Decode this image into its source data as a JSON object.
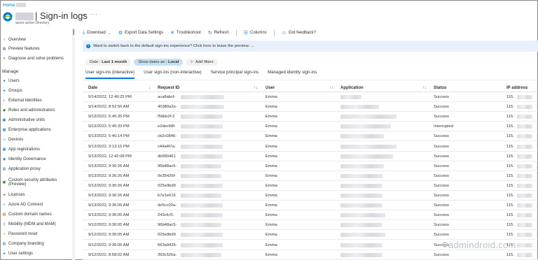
{
  "breadcrumb": {
    "home": "Home"
  },
  "header": {
    "title": "| Sign-in logs",
    "subtitle": "azure active Directory",
    "pin_icon": "pin-icon",
    "more_label": "···"
  },
  "sidebar": {
    "section_manage": "Manage",
    "items": [
      {
        "label": "Overview",
        "icon": "info-icon",
        "color": "#0078d4"
      },
      {
        "label": "Preview features",
        "icon": "preview-icon",
        "color": "#8764b8"
      },
      {
        "label": "Diagnose and solve problems",
        "icon": "wrench-icon",
        "color": "#605e5c"
      },
      {
        "label": "Users",
        "icon": "user-icon",
        "color": "#0078d4"
      },
      {
        "label": "Groups",
        "icon": "groups-icon",
        "color": "#0078d4"
      },
      {
        "label": "External Identities",
        "icon": "external-icon",
        "color": "#0078d4"
      },
      {
        "label": "Roles and administrators",
        "icon": "roles-icon",
        "color": "#107c10"
      },
      {
        "label": "Administrative units",
        "icon": "admin-units-icon",
        "color": "#0078d4"
      },
      {
        "label": "Enterprise applications",
        "icon": "apps-icon",
        "color": "#0078d4"
      },
      {
        "label": "Devices",
        "icon": "device-icon",
        "color": "#0078d4"
      },
      {
        "label": "App registrations",
        "icon": "app-reg-icon",
        "color": "#0078d4"
      },
      {
        "label": "Identity Governance",
        "icon": "governance-icon",
        "color": "#0078d4"
      },
      {
        "label": "Application proxy",
        "icon": "proxy-icon",
        "color": "#0078d4"
      },
      {
        "label": "Custom security attributes (Preview)",
        "icon": "attributes-icon",
        "color": "#107c10"
      },
      {
        "label": "Licenses",
        "icon": "license-icon",
        "color": "#d83b01"
      },
      {
        "label": "Azure AD Connect",
        "icon": "connect-icon",
        "color": "#0078d4"
      },
      {
        "label": "Custom domain names",
        "icon": "domain-icon",
        "color": "#d83b01"
      },
      {
        "label": "Mobility (MDM and MAM)",
        "icon": "mobility-icon",
        "color": "#0078d4"
      },
      {
        "label": "Password reset",
        "icon": "key-icon",
        "color": "#ffb900"
      },
      {
        "label": "Company branding",
        "icon": "branding-icon",
        "color": "#0078d4"
      },
      {
        "label": "User settings",
        "icon": "user-settings-icon",
        "color": "#0078d4"
      }
    ]
  },
  "toolbar": {
    "download": "Download",
    "export": "Export Data Settings",
    "troubleshoot": "Troubleshoot",
    "refresh": "Refresh",
    "columns": "Columns",
    "feedback": "Got feedback?"
  },
  "banner": {
    "text": "Want to switch back to the default sign-ins experience? Click here to leave the preview. →"
  },
  "filters": {
    "date_prefix": "Date : ",
    "date_value": "Last 1 month",
    "show_prefix": "Show dates as : ",
    "show_value": "Local",
    "add": "Add filters"
  },
  "tabs": [
    {
      "label": "User sign-ins (interactive)",
      "active": true
    },
    {
      "label": "User sign-ins (non-interactive)",
      "active": false
    },
    {
      "label": "Service principal sign-ins",
      "active": false
    },
    {
      "label": "Managed identity sign-ins",
      "active": false
    }
  ],
  "table": {
    "headers": {
      "date": "Date",
      "request_id": "Request ID",
      "user": "User",
      "application": "Application",
      "status": "Status",
      "ip": "IP address"
    },
    "rows": [
      {
        "date": "9/14/2022, 12:49:25 PM",
        "request_id": "aca8abcf-",
        "user": "Emma",
        "status": "Success",
        "ip": "115."
      },
      {
        "date": "9/14/2022, 8:52:50 AM",
        "request_id": "40380a2e-",
        "user": "Emma",
        "status": "Success",
        "ip": "115."
      },
      {
        "date": "9/13/2022, 5:45:35 PM",
        "request_id": "f56bb2f-2",
        "user": "Emma",
        "status": "Success",
        "ip": "115."
      },
      {
        "date": "9/13/2022, 5:45:33 PM",
        "request_id": "e2dec68f-",
        "user": "Emma",
        "status": "Interrupted",
        "ip": "115."
      },
      {
        "date": "9/13/2022, 5:40:14 PM",
        "request_id": "cb2c0846-",
        "user": "Emma",
        "status": "Success",
        "ip": "115."
      },
      {
        "date": "9/13/2022, 3:13:15 PM",
        "request_id": "c44af47a-",
        "user": "Emma",
        "status": "Success",
        "ip": "115."
      },
      {
        "date": "9/13/2022, 12:42:08 PM",
        "request_id": "db990461",
        "user": "Emma",
        "status": "Success",
        "ip": "115."
      },
      {
        "date": "9/13/2022, 9:36:26 AM",
        "request_id": "96b48ac5-",
        "user": "Emma",
        "status": "Success",
        "ip": "115."
      },
      {
        "date": "9/13/2022, 9:36:26 AM",
        "request_id": "0e35426f-",
        "user": "Emma",
        "status": "Success",
        "ip": "115."
      },
      {
        "date": "9/13/2022, 9:36:26 AM",
        "request_id": "025e9bd9",
        "user": "Emma",
        "status": "Success",
        "ip": "115."
      },
      {
        "date": "9/13/2022, 9:36:26 AM",
        "request_id": "b7e1e616",
        "user": "Emma",
        "status": "Success",
        "ip": "115."
      },
      {
        "date": "9/13/2022, 9:36:05 AM",
        "request_id": "de5cc02a-",
        "user": "Emma",
        "status": "Success",
        "ip": "115."
      },
      {
        "date": "9/13/2022, 9:36:05 AM",
        "request_id": "243cfcf1-",
        "user": "Emma",
        "status": "Success",
        "ip": "115."
      },
      {
        "date": "9/12/2022, 9:36:05 AM",
        "request_id": "96b48ac5-",
        "user": "Emma",
        "status": "Success",
        "ip": "115."
      },
      {
        "date": "9/12/2022, 9:36:05 AM",
        "request_id": "025e9bd9",
        "user": "Emma",
        "status": "Success",
        "ip": "115."
      },
      {
        "date": "9/12/2022, 9:36:05 AM",
        "request_id": "663a9426-",
        "user": "Emma",
        "status": "Success",
        "ip": "115."
      },
      {
        "date": "9/12/2022, 8:58:02 AM",
        "request_id": "393c526a-",
        "user": "Emma",
        "status": "Success",
        "ip": "115."
      }
    ]
  },
  "watermark": {
    "text": "admindroid.com"
  }
}
